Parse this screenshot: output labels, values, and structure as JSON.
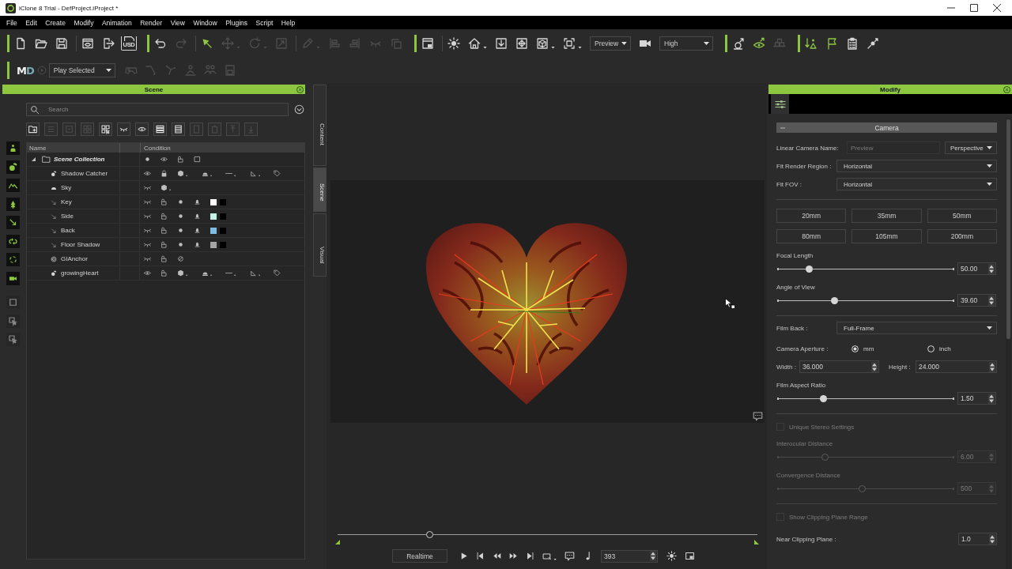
{
  "window": {
    "title": "iClone 8 Trial - DefProject.iProject *"
  },
  "menu": [
    "File",
    "Edit",
    "Create",
    "Modify",
    "Animation",
    "Render",
    "View",
    "Window",
    "Plugins",
    "Script",
    "Help"
  ],
  "toolbar": {
    "groups": [
      [
        {
          "kind": "icon",
          "disabled": false
        },
        {
          "kind": "icon",
          "disabled": false
        },
        {
          "kind": "icon",
          "disabled": false
        },
        {
          "kind": "icon",
          "disabled": false
        },
        {
          "kind": "icon",
          "disabled": false
        },
        {
          "kind": "labeled_icon",
          "label": "USD",
          "disabled": false
        }
      ],
      [
        {
          "kind": "icon",
          "disabled": false
        },
        {
          "kind": "icon",
          "disabled": true
        },
        {
          "kind": "icon",
          "disabled": false
        },
        {
          "kind": "icon",
          "disabled": true
        },
        {
          "kind": "icon",
          "disabled": true
        },
        {
          "kind": "icon",
          "disabled": true
        },
        {
          "kind": "icon",
          "disabled": true
        },
        {
          "kind": "icon",
          "disabled": true
        },
        {
          "kind": "icon",
          "disabled": true
        },
        {
          "kind": "icon",
          "disabled": true
        },
        {
          "kind": "icon",
          "disabled": true
        }
      ],
      [
        {
          "kind": "icon",
          "disabled": false
        },
        {
          "kind": "icon",
          "disabled": false
        },
        {
          "kind": "icon",
          "disabled": false
        },
        {
          "kind": "icon",
          "disabled": false
        },
        {
          "kind": "icon",
          "disabled": false
        },
        {
          "kind": "icon",
          "disabled": false
        },
        {
          "kind": "icon",
          "disabled": false
        },
        {
          "kind": "dropdown",
          "value": "Preview"
        },
        {
          "kind": "icon",
          "disabled": false
        },
        {
          "kind": "dropdown",
          "value": "High"
        }
      ],
      [
        {
          "kind": "icon",
          "disabled": false
        },
        {
          "kind": "icon",
          "disabled": false
        },
        {
          "kind": "icon",
          "disabled": true
        }
      ],
      [
        {
          "kind": "icon",
          "disabled": false
        },
        {
          "kind": "icon",
          "disabled": false
        },
        {
          "kind": "icon",
          "disabled": false
        },
        {
          "kind": "icon",
          "disabled": false
        }
      ]
    ]
  },
  "subtoolbar": {
    "logo": [
      "M",
      "D"
    ],
    "play": {
      "disabled": true
    },
    "mode": "Play Selected",
    "tools": [
      {
        "disabled": true
      },
      {
        "disabled": true
      },
      {
        "disabled": true
      },
      {
        "disabled": true
      },
      {
        "disabled": true
      },
      {
        "disabled": true
      }
    ]
  },
  "scene_panel": {
    "title": "Scene",
    "search": {
      "placeholder": "Search"
    },
    "tools": [
      {
        "disabled": false
      },
      {
        "disabled": true
      },
      {
        "disabled": true
      },
      {
        "disabled": true
      },
      {
        "disabled": false
      },
      {
        "disabled": false
      },
      {
        "disabled": false
      },
      {
        "disabled": false
      },
      {
        "disabled": false
      },
      {
        "disabled": true
      },
      {
        "disabled": true
      },
      {
        "disabled": true
      },
      {
        "disabled": true
      }
    ],
    "side_tools": [
      {
        "disabled": false
      },
      {
        "disabled": false
      },
      {
        "disabled": false
      },
      {
        "disabled": false
      },
      {
        "disabled": false
      },
      {
        "disabled": false
      },
      {
        "disabled": false
      },
      {
        "disabled": false
      },
      {
        "disabled": true
      },
      {
        "disabled": true
      },
      {
        "disabled": true
      }
    ],
    "columns": [
      "Name",
      "Condition"
    ],
    "tree": [
      {
        "name": "Scene Collection",
        "kind": "collection",
        "expanded": true,
        "visible": true,
        "locked": false,
        "children": [
          {
            "name": "Shadow Catcher",
            "kind": "prop",
            "visible": true,
            "locked": true
          },
          {
            "name": "Sky",
            "kind": "sky",
            "visible": false
          },
          {
            "name": "Key",
            "kind": "light",
            "visible": false,
            "locked": false,
            "color": "#ffffff"
          },
          {
            "name": "Side",
            "kind": "light",
            "visible": false,
            "locked": false,
            "color": "#c4f2e6"
          },
          {
            "name": "Back",
            "kind": "light",
            "visible": false,
            "locked": false,
            "color": "#80bce4"
          },
          {
            "name": "Floor Shadow",
            "kind": "light",
            "visible": false,
            "locked": false,
            "color": "#a6a6a6"
          },
          {
            "name": "GIAnchor",
            "kind": "anchor",
            "visible": false,
            "locked": false
          },
          {
            "name": "growingHeart",
            "kind": "prop",
            "visible": true,
            "locked": false
          }
        ]
      }
    ]
  },
  "side_tabs": [
    {
      "label": "Content",
      "selected": false
    },
    {
      "label": "Scene",
      "selected": true
    },
    {
      "label": "Visual",
      "selected": false
    }
  ],
  "viewport": {
    "timeline": {
      "level": 0.22
    },
    "speed": "Realtime",
    "frame": "393"
  },
  "modify_panel": {
    "title": "Modify",
    "section": {
      "title": "Camera",
      "expanded": true
    },
    "controls": [
      {
        "kind": "name_row",
        "label": "Linear Camera Name:",
        "placeholder": "Preview",
        "value": "Perspective"
      },
      {
        "kind": "combo",
        "label": "Fit Render Region :",
        "value": "Horizontal"
      },
      {
        "kind": "combo",
        "label": "Fit FOV :",
        "value": "Horizontal"
      },
      {
        "kind": "divider"
      },
      {
        "kind": "buttons",
        "items": [
          "20mm",
          "35mm",
          "50mm",
          "80mm",
          "105mm",
          "200mm"
        ]
      },
      {
        "kind": "slider",
        "label": "Focal Length",
        "level": 0.18,
        "value": "50.00",
        "disabled": false
      },
      {
        "kind": "slider",
        "label": "Angle of View",
        "level": 0.32,
        "value": "39.60",
        "disabled": false
      },
      {
        "kind": "divider"
      },
      {
        "kind": "combo",
        "label": "Film Back :",
        "value": "Full-Frame"
      },
      {
        "kind": "radio",
        "label": "Camera Aperture :",
        "options": [
          {
            "label": "mm",
            "selected": true
          },
          {
            "label": "inch",
            "selected": false
          }
        ]
      },
      {
        "kind": "pair",
        "fields": [
          {
            "label": "Width :",
            "value": "36.000"
          },
          {
            "label": "Height :",
            "value": "24.000"
          }
        ]
      },
      {
        "kind": "slider",
        "label": "Film Aspect Ratio",
        "level": 0.26,
        "value": "1.50",
        "disabled": false
      },
      {
        "kind": "divider"
      },
      {
        "kind": "checkbox",
        "label": "Unique Stereo Settings",
        "checked": false,
        "disabled": true
      },
      {
        "kind": "slider",
        "label": "Interocular Distance",
        "level": 0.27,
        "value": "6.00",
        "disabled": true
      },
      {
        "kind": "slider",
        "label": "Convergence Distance",
        "level": 0.48,
        "value": "500",
        "disabled": true
      },
      {
        "kind": "divider"
      },
      {
        "kind": "checkbox",
        "label": "Show Clipping Plane Range",
        "checked": false,
        "disabled": true
      },
      {
        "kind": "number",
        "label": "Near Clipping Plane :",
        "value": "1.0"
      }
    ]
  }
}
